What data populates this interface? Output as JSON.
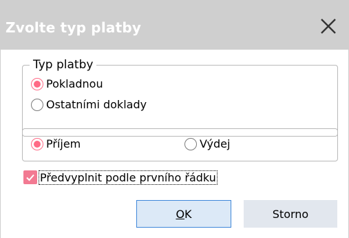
{
  "window": {
    "title": "Zvolte typ platby"
  },
  "group_type": {
    "legend": "Typ platby",
    "options": [
      {
        "label": "Pokladnou",
        "checked": true
      },
      {
        "label": "Ostatními doklady",
        "checked": false
      }
    ]
  },
  "group_direction": {
    "options": [
      {
        "label": "Příjem",
        "checked": true
      },
      {
        "label": "Výdej",
        "checked": false
      }
    ]
  },
  "prefill": {
    "label": "Předvyplnit podle prvního řádku",
    "checked": true
  },
  "buttons": {
    "ok_label": "OK",
    "cancel_label": "Storno"
  },
  "colors": {
    "accent": "#ff6b86",
    "checkbox_fill": "#f27a92",
    "titlebar": "#cfcfcf",
    "ok_border": "#3f87d9",
    "ok_bg": "#dce9f7",
    "cancel_bg": "#e2e7ee"
  },
  "icons": {
    "close": "close-icon",
    "check": "checkmark-icon"
  }
}
